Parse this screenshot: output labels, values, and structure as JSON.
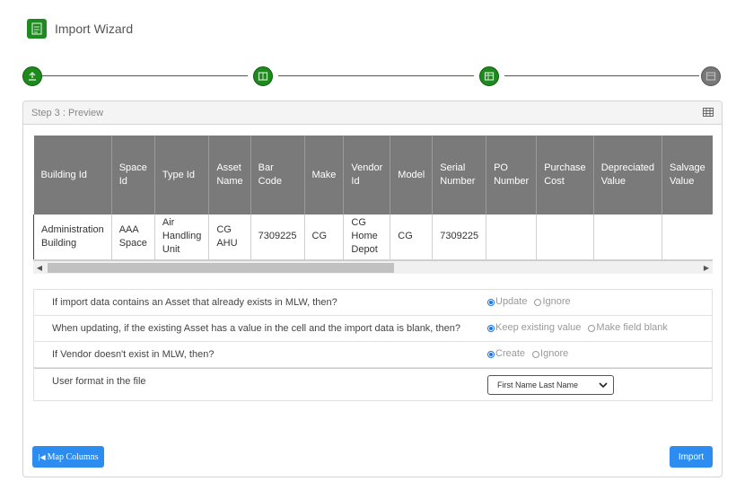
{
  "header": {
    "title": "Import Wizard",
    "icon": "import-file-icon"
  },
  "stepper": {
    "steps": [
      {
        "icon": "upload-icon",
        "state": "done"
      },
      {
        "icon": "columns-icon",
        "state": "done"
      },
      {
        "icon": "preview-grid-icon",
        "state": "done"
      },
      {
        "icon": "finish-icon",
        "state": "pending"
      }
    ],
    "colors": {
      "done": "#1e8a1e",
      "pending": "#777777"
    }
  },
  "panel": {
    "title": "Step 3 : Preview",
    "icon": "grid-icon"
  },
  "table": {
    "columns": [
      "Building Id",
      "Space Id",
      "Type Id",
      "Asset Name",
      "Bar Code",
      "Make",
      "Vendor Id",
      "Model",
      "Serial Number",
      "PO Number",
      "Purchase Cost",
      "Depreciated Value",
      "Salvage Value"
    ],
    "rows": [
      [
        "Administration Building",
        "AAA Space",
        "Air Handling Unit",
        "CG AHU",
        "7309225",
        "CG",
        "CG Home Depot",
        "CG",
        "7309225",
        "",
        "",
        "",
        ""
      ]
    ]
  },
  "options": {
    "q1": {
      "question": "If import data contains an Asset that already exists in MLW, then?",
      "choices": [
        "Update",
        "Ignore"
      ],
      "selected": 0
    },
    "q2": {
      "question": "When updating, if the existing Asset has a value in the cell and the import data is blank, then?",
      "choices": [
        "Keep existing value",
        "Make field blank"
      ],
      "selected": 0
    },
    "q3": {
      "question": "If Vendor doesn't exist in MLW, then?",
      "choices": [
        "Create",
        "Ignore"
      ],
      "selected": 0
    },
    "q4": {
      "question": "User format in the file",
      "select_value": "First Name Last Name"
    }
  },
  "buttons": {
    "map_columns": "Map Columns",
    "import": "Import"
  },
  "colors": {
    "accent": "#2d8cf0",
    "radio": "#1a73e8",
    "table_header": "#7a7a7a"
  }
}
